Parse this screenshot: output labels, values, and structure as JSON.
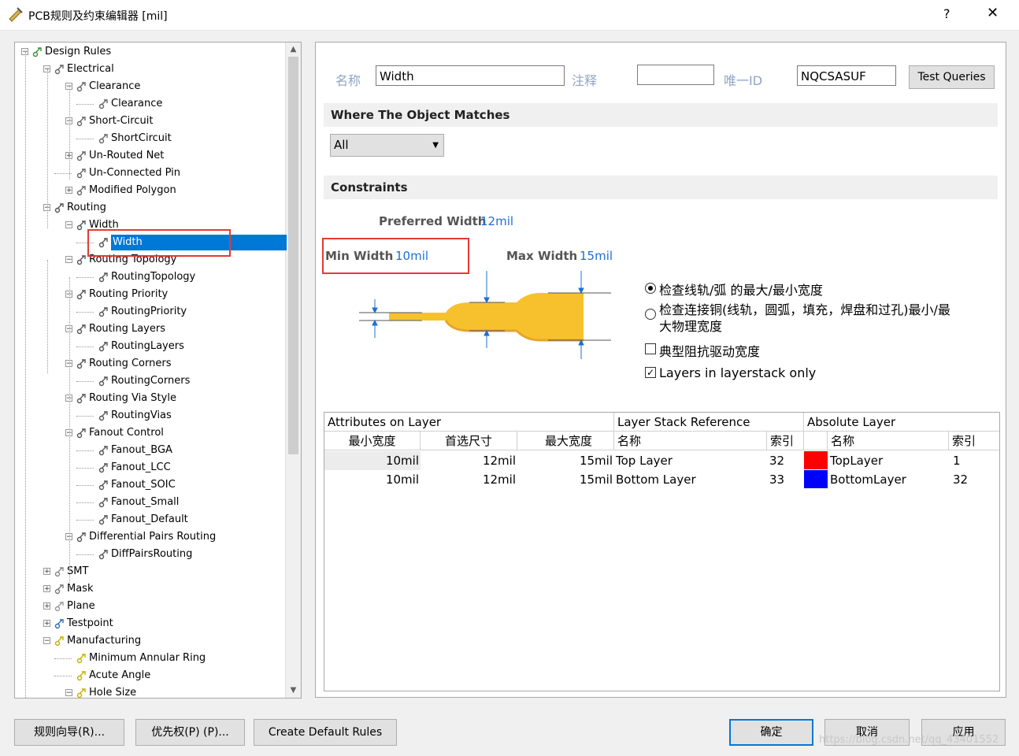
{
  "window": {
    "title": "PCB规则及约束编辑器 [mil]",
    "help_label": "?",
    "close_label": "✕"
  },
  "tree": {
    "items": [
      {
        "label": "Design Rules",
        "icon": "design-rules-icon"
      },
      {
        "label": "Electrical",
        "icon": "electrical-rule-icon"
      },
      {
        "label": "Clearance",
        "icon": "electrical-rule-icon"
      },
      {
        "label": "Clearance",
        "icon": "electrical-rule-icon"
      },
      {
        "label": "Short-Circuit",
        "icon": "electrical-rule-icon"
      },
      {
        "label": "ShortCircuit",
        "icon": "electrical-rule-icon"
      },
      {
        "label": "Un-Routed Net",
        "icon": "electrical-rule-icon"
      },
      {
        "label": "Un-Connected Pin",
        "icon": "electrical-rule-icon"
      },
      {
        "label": "Modified Polygon",
        "icon": "electrical-rule-icon"
      },
      {
        "label": "Routing",
        "icon": "routing-rule-icon"
      },
      {
        "label": "Width",
        "icon": "routing-rule-icon"
      },
      {
        "label": "Width",
        "icon": "routing-rule-icon"
      },
      {
        "label": "Routing Topology",
        "icon": "routing-rule-icon"
      },
      {
        "label": "RoutingTopology",
        "icon": "routing-rule-icon"
      },
      {
        "label": "Routing Priority",
        "icon": "routing-rule-icon"
      },
      {
        "label": "RoutingPriority",
        "icon": "routing-rule-icon"
      },
      {
        "label": "Routing Layers",
        "icon": "routing-rule-icon"
      },
      {
        "label": "RoutingLayers",
        "icon": "routing-rule-icon"
      },
      {
        "label": "Routing Corners",
        "icon": "routing-rule-icon"
      },
      {
        "label": "RoutingCorners",
        "icon": "routing-rule-icon"
      },
      {
        "label": "Routing Via Style",
        "icon": "routing-rule-icon"
      },
      {
        "label": "RoutingVias",
        "icon": "routing-rule-icon"
      },
      {
        "label": "Fanout Control",
        "icon": "routing-rule-icon"
      },
      {
        "label": "Fanout_BGA",
        "icon": "routing-rule-icon"
      },
      {
        "label": "Fanout_LCC",
        "icon": "routing-rule-icon"
      },
      {
        "label": "Fanout_SOIC",
        "icon": "routing-rule-icon"
      },
      {
        "label": "Fanout_Small",
        "icon": "routing-rule-icon"
      },
      {
        "label": "Fanout_Default",
        "icon": "routing-rule-icon"
      },
      {
        "label": "Differential Pairs Routing",
        "icon": "routing-rule-icon"
      },
      {
        "label": "DiffPairsRouting",
        "icon": "routing-rule-icon"
      },
      {
        "label": "SMT",
        "icon": "smt-rule-icon"
      },
      {
        "label": "Mask",
        "icon": "mask-rule-icon"
      },
      {
        "label": "Plane",
        "icon": "plane-rule-icon"
      },
      {
        "label": "Testpoint",
        "icon": "testpoint-rule-icon"
      },
      {
        "label": "Manufacturing",
        "icon": "manufacturing-rule-icon"
      },
      {
        "label": "Minimum Annular Ring",
        "icon": "manufacturing-rule-icon"
      },
      {
        "label": "Acute Angle",
        "icon": "manufacturing-rule-icon"
      },
      {
        "label": "Hole Size",
        "icon": "manufacturing-rule-icon"
      }
    ]
  },
  "header": {
    "name_label": "名称",
    "name_value": "Width",
    "comment_label": "注释",
    "comment_value": "",
    "uid_label": "唯一ID",
    "uid_value": "NQCSASUF",
    "test_queries": "Test Queries"
  },
  "where": {
    "heading": "Where The Object Matches",
    "combo_value": "All"
  },
  "constraints": {
    "heading": "Constraints",
    "preferred_label": "Preferred Width",
    "preferred_value": "12mil",
    "min_label": "Min Width",
    "min_value": "10mil",
    "max_label": "Max Width",
    "max_value": "15mil",
    "options": [
      {
        "text": "检查线轨/弧 的最大/最小宽度",
        "type": "radio",
        "checked": true
      },
      {
        "text": "检查连接铜(线轨，圆弧，填充，焊盘和过孔)最小/最",
        "text2": "大物理宽度",
        "type": "radio",
        "checked": false
      },
      {
        "text": "典型阻抗驱动宽度",
        "type": "check",
        "checked": false
      },
      {
        "text": "Layers in layerstack only",
        "type": "check",
        "checked": true
      }
    ],
    "colors": {
      "trace": "#f7c12e",
      "trace_shadow": "#e6a42a",
      "arrow": "#1e6fd0"
    }
  },
  "grid": {
    "group_headers": [
      "Attributes on Layer",
      "Layer Stack Reference",
      "Absolute Layer"
    ],
    "columns": [
      "最小宽度",
      "首选尺寸",
      "最大宽度",
      "名称",
      "索引",
      "名称",
      "索引"
    ],
    "rows": [
      {
        "min": "10mil",
        "pref": "12mil",
        "max": "15mil",
        "stack_name": "Top Layer",
        "stack_idx": "32",
        "color": "#ff0000",
        "abs_name": "TopLayer",
        "abs_idx": "1"
      },
      {
        "min": "10mil",
        "pref": "12mil",
        "max": "15mil",
        "stack_name": "Bottom Layer",
        "stack_idx": "33",
        "color": "#0000ff",
        "abs_name": "BottomLayer",
        "abs_idx": "32"
      }
    ]
  },
  "footer": {
    "rule_wizard": "规则向导(R)...",
    "priorities": "优先权(P) (P)...",
    "create_default": "Create Default Rules",
    "ok": "确定",
    "cancel": "取消",
    "apply": "应用"
  },
  "watermark": "https://blog.csdn.net/qq_43401552"
}
